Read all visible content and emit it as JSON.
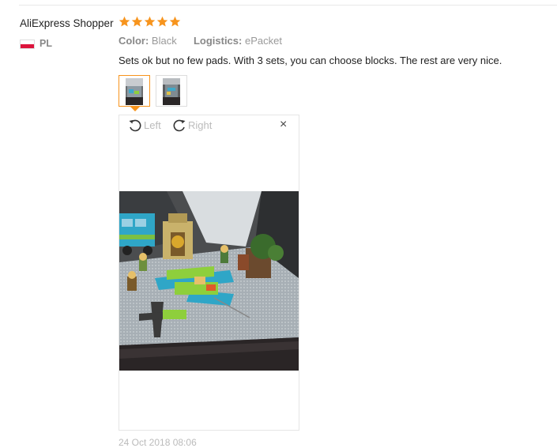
{
  "review": {
    "user_name": "AliExpress Shopper",
    "rating": 5,
    "country": "PL",
    "color_label": "Color:",
    "color_value": "Black",
    "logistics_label": "Logistics:",
    "logistics_value": "ePacket",
    "text": "Sets ok but no few pads. With 3 sets, you can choose blocks. The rest are very nice.",
    "date": "24 Oct 2018 08:06"
  },
  "viewer": {
    "rotate_left_label": "Left",
    "rotate_right_label": "Right",
    "close_symbol": "×"
  },
  "colors": {
    "accent": "#f7941d"
  }
}
